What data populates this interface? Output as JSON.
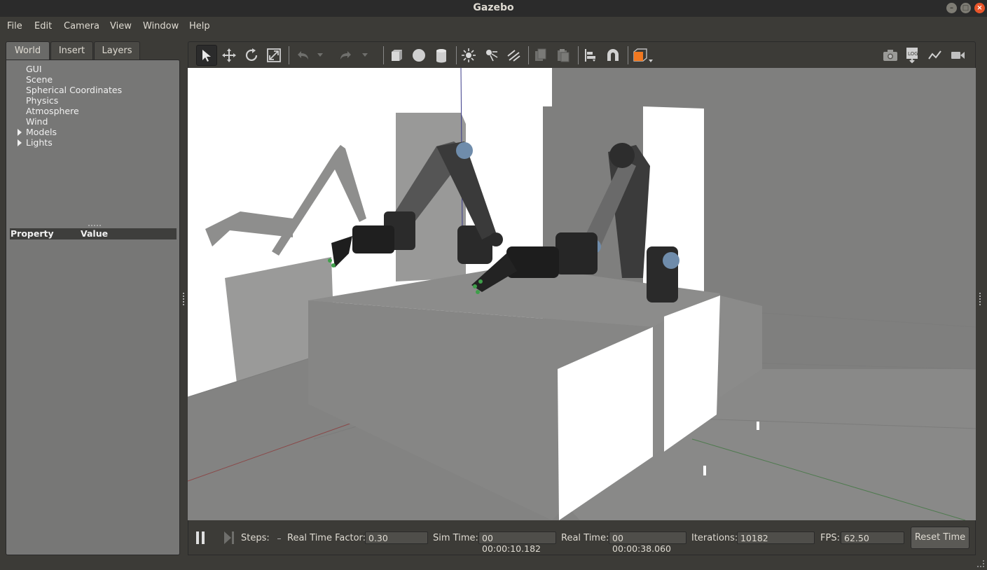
{
  "window": {
    "title": "Gazebo"
  },
  "menu": [
    "File",
    "Edit",
    "Camera",
    "View",
    "Window",
    "Help"
  ],
  "left_panel": {
    "tabs": [
      "World",
      "Insert",
      "Layers"
    ],
    "active_tab": "World",
    "tree": [
      {
        "label": "GUI",
        "expandable": false
      },
      {
        "label": "Scene",
        "expandable": false
      },
      {
        "label": "Spherical Coordinates",
        "expandable": false
      },
      {
        "label": "Physics",
        "expandable": false
      },
      {
        "label": "Atmosphere",
        "expandable": false
      },
      {
        "label": "Wind",
        "expandable": false
      },
      {
        "label": "Models",
        "expandable": true
      },
      {
        "label": "Lights",
        "expandable": true
      }
    ],
    "property_header": {
      "property": "Property",
      "value": "Value"
    }
  },
  "toolbar": {
    "tools": [
      "select-icon",
      "translate-icon",
      "rotate-icon",
      "scale-icon",
      "undo-icon",
      "redo-icon",
      "box-icon",
      "sphere-icon",
      "cylinder-icon",
      "point-light-icon",
      "spot-light-icon",
      "directional-light-icon",
      "copy-icon",
      "paste-icon",
      "align-icon",
      "snap-icon",
      "view-angle-icon",
      "screenshot-icon",
      "log-icon",
      "plot-icon",
      "video-record-icon"
    ],
    "accent": "#f07820"
  },
  "bottom_bar": {
    "steps_label": "Steps:",
    "rtf_label": "Real Time Factor:",
    "rtf_value": "0.30",
    "sim_time_label": "Sim Time:",
    "sim_time_value": "00 00:00:10.182",
    "real_time_label": "Real Time:",
    "real_time_value": "00 00:00:38.060",
    "iterations_label": "Iterations:",
    "iterations_value": "10182",
    "fps_label": "FPS:",
    "fps_value": "62.50",
    "reset_label": "Reset Time"
  },
  "colors": {
    "background": "#3c3b37",
    "panel": "#777776",
    "viewport_floor": "#898988",
    "close_button": "#e9552a"
  }
}
